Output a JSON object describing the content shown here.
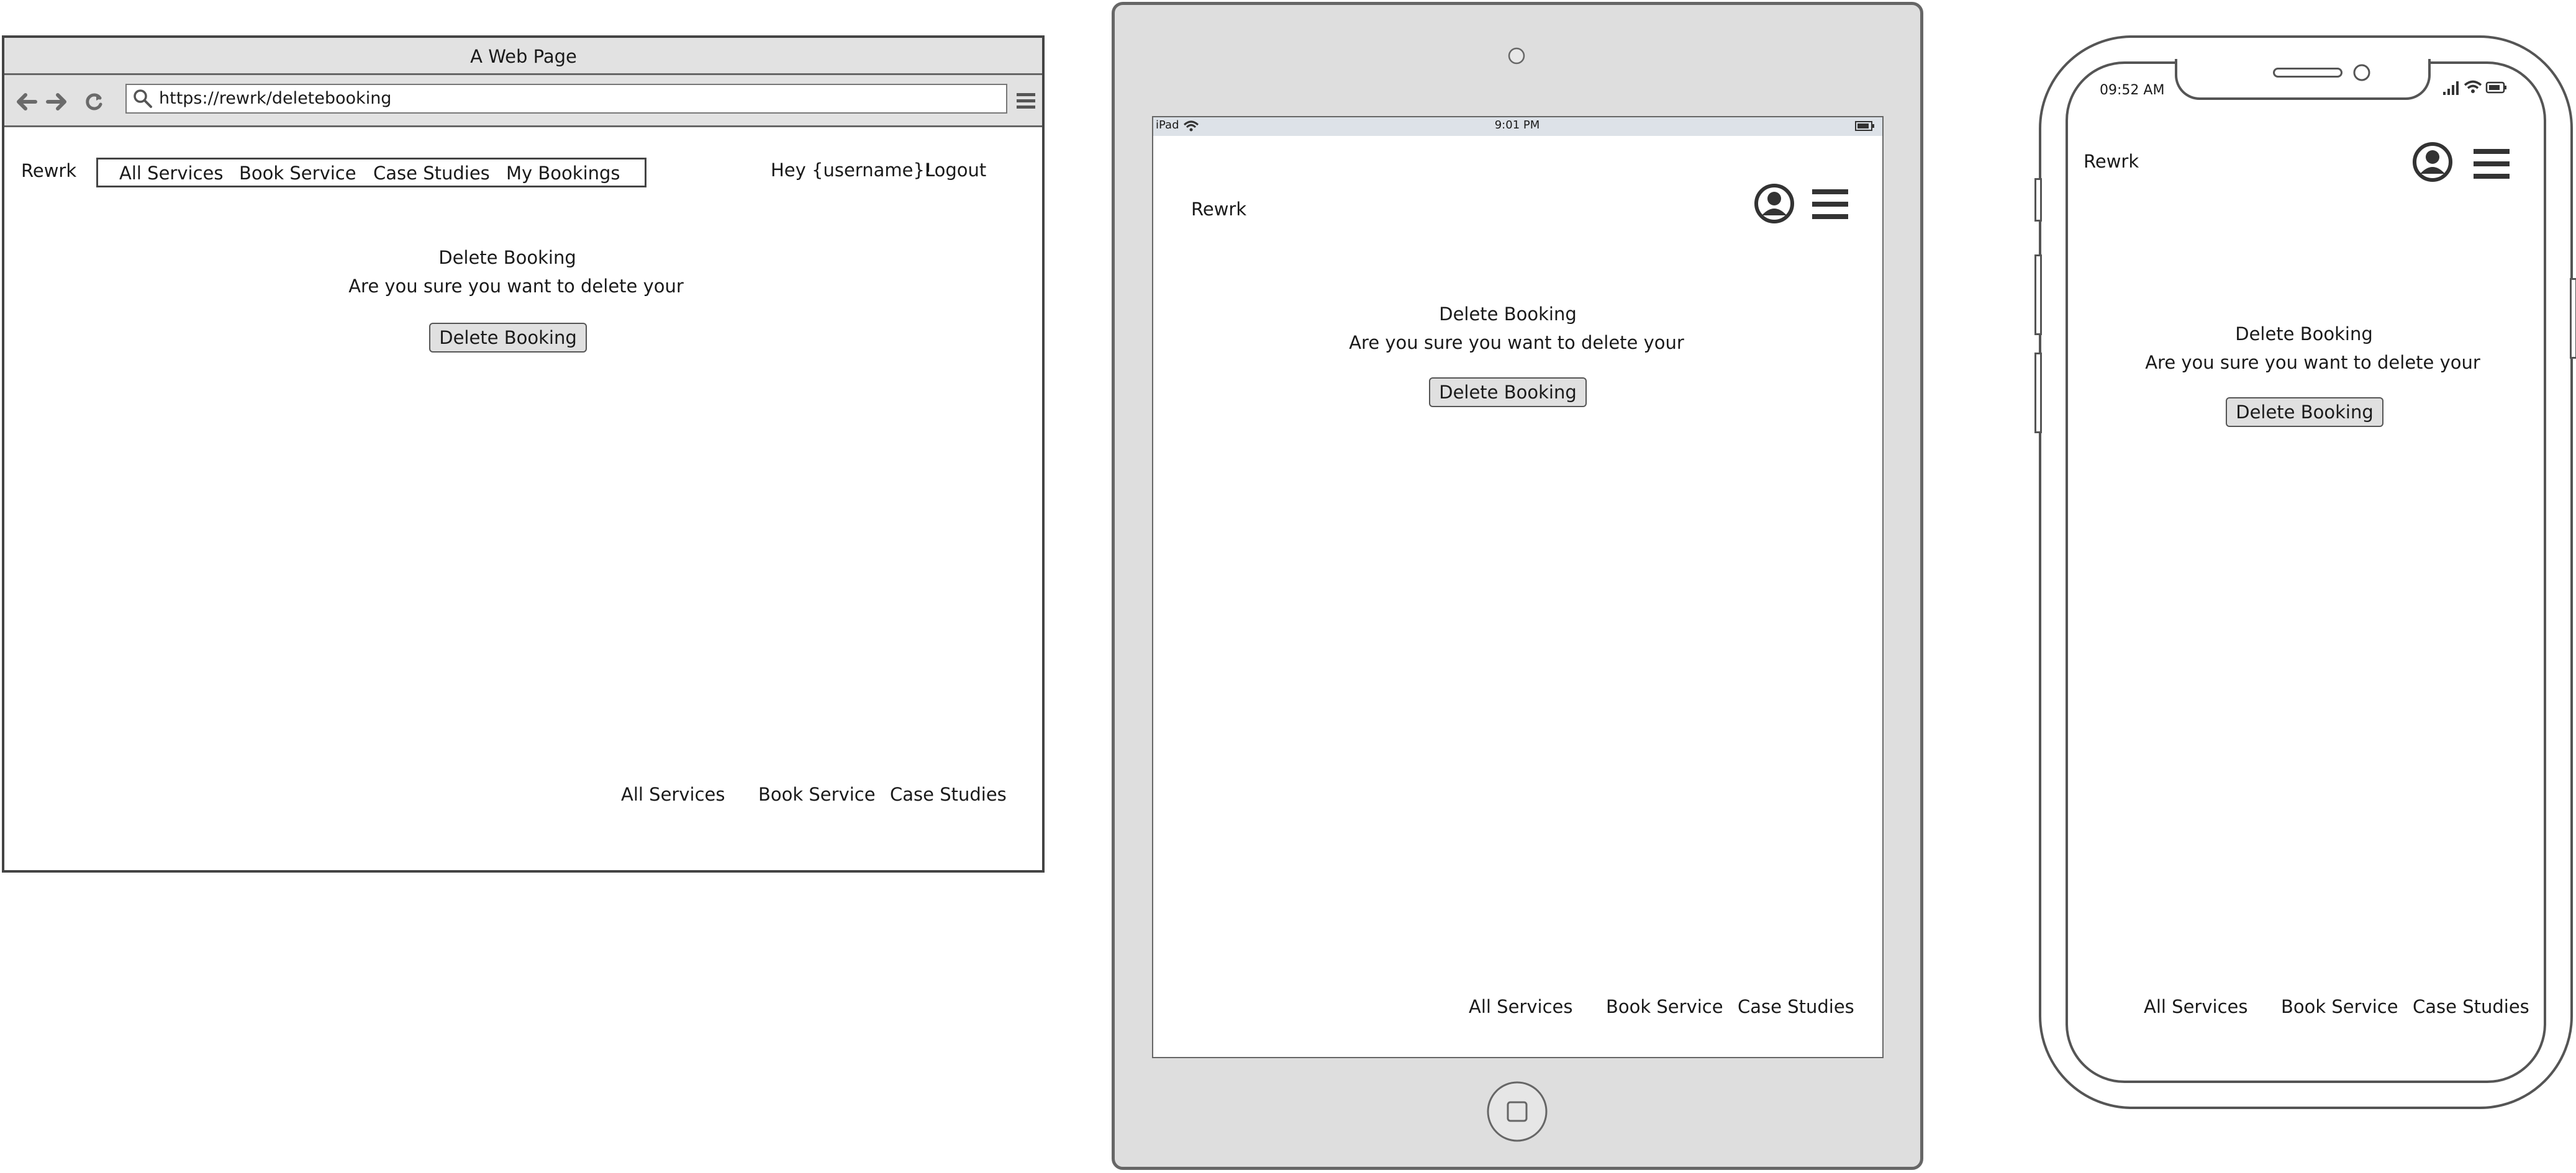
{
  "desktop": {
    "window_title": "A Web Page",
    "url": "https://rewrk/deletebooking",
    "brand": "Rewrk",
    "nav": [
      "All Services",
      "Book Service",
      "Case Studies",
      "My Bookings"
    ],
    "greeting": "Hey {username}!",
    "logout": "Logout",
    "heading": "Delete Booking",
    "message": "Are you sure you want to delete your",
    "button": "Delete Booking",
    "footer": [
      "All Services",
      "Book Service",
      "Case Studies"
    ]
  },
  "tablet": {
    "status_device": "iPad",
    "status_time": "9:01 PM",
    "brand": "Rewrk",
    "heading": "Delete Booking",
    "message": "Are you sure you want to delete your",
    "button": "Delete Booking",
    "footer": [
      "All Services",
      "Book Service",
      "Case Studies"
    ],
    "icons": [
      "wifi-icon",
      "battery-icon",
      "user-account-icon",
      "hamburger-menu-icon",
      "home-button-icon",
      "front-camera-icon"
    ]
  },
  "phone": {
    "status_time": "09:52 AM",
    "brand": "Rewrk",
    "heading": "Delete Booking",
    "message": "Are you sure you want to delete your",
    "button": "Delete Booking",
    "footer": [
      "All Services",
      "Book Service",
      "Case Studies"
    ],
    "icons": [
      "cellular-signal-icon",
      "wifi-icon",
      "battery-icon",
      "user-account-icon",
      "hamburger-menu-icon"
    ]
  }
}
